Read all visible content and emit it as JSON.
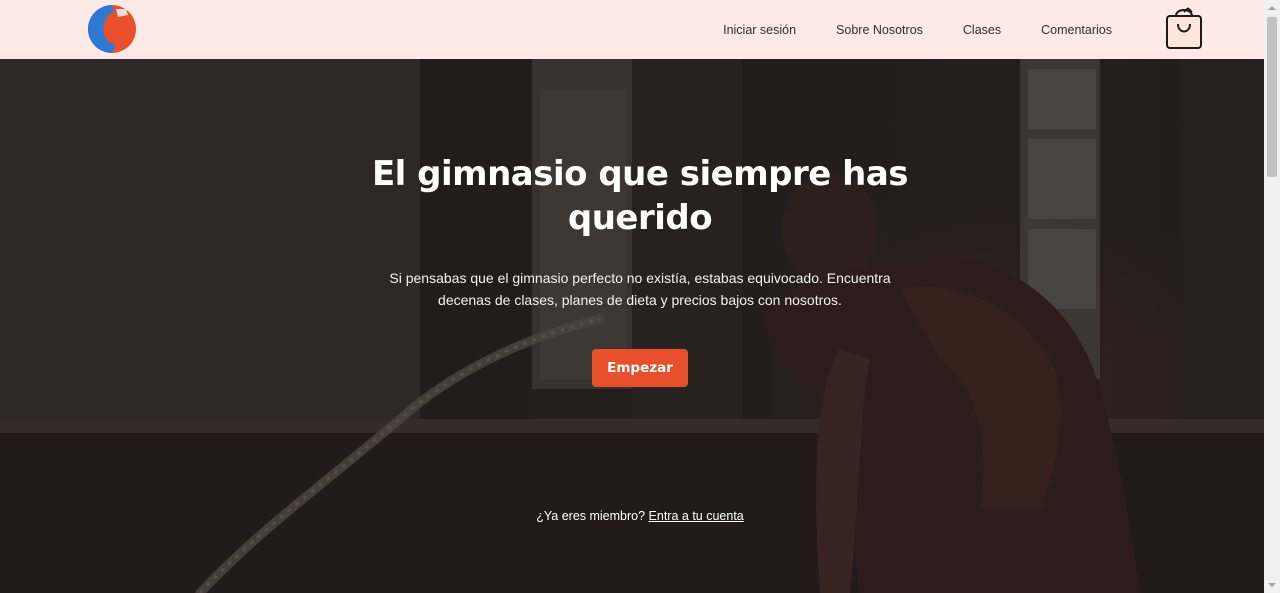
{
  "header": {
    "logo_icon": "bicep-arm-logo-icon",
    "nav": [
      {
        "label": "Iniciar sesión"
      },
      {
        "label": "Sobre Nosotros"
      },
      {
        "label": "Clases"
      },
      {
        "label": "Comentarios"
      }
    ],
    "cart_icon": "shopping-bag-icon"
  },
  "hero": {
    "title": "El gimnasio que siempre has querido",
    "subtitle": "Si pensabas que el gimnasio perfecto no existía, estabas equivocado. Encuentra decenas de clases, planes de dieta y precios bajos con nosotros.",
    "cta_label": "Empezar",
    "member_prompt": "¿Ya eres miembro?",
    "member_link": "Entra a tu cuenta"
  },
  "colors": {
    "header_bg": "#fde9e5",
    "accent": "#e8502c",
    "logo_blue": "#2e78d6",
    "hero_text": "#ffffff"
  }
}
